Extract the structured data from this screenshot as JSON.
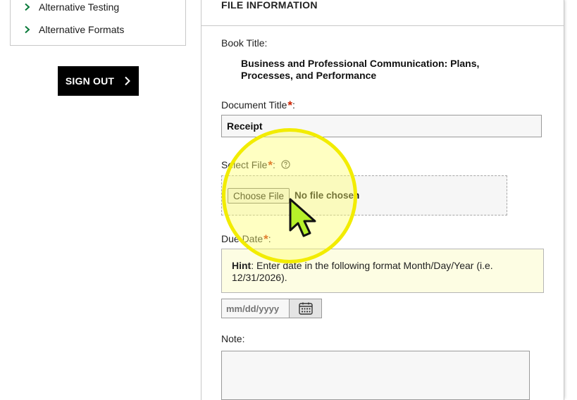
{
  "sidebar": {
    "items": [
      {
        "label": "Alternative Testing",
        "icon": "chevron-right-icon"
      },
      {
        "label": "Alternative Formats",
        "icon": "chevron-right-icon"
      }
    ],
    "sign_out_label": "SIGN OUT",
    "sign_out_icon": "chevron-right-icon"
  },
  "form": {
    "section_title": "FILE INFORMATION",
    "book_title_label": "Book Title:",
    "book_title_value": "Business and Professional Communication: Plans, Processes, and Performance",
    "document_title_label": "Document Title",
    "document_title_value": "Receipt",
    "select_file_label": "Select File",
    "help_icon": "question-circle-icon",
    "choose_file_label": "Choose File",
    "no_file_text": "No file chosen",
    "due_date_label": "Due Date",
    "hint_bold": "Hint",
    "hint_text": ": Enter date in the following format Month/Day/Year (i.e. 12/31/2026).",
    "date_placeholder": "mm/dd/yyyy",
    "calendar_icon": "calendar-icon",
    "note_label": "Note:",
    "required_mark": "*",
    "colon": ":"
  },
  "colors": {
    "accent_green": "#0a7a3a",
    "required_red": "#cc2200",
    "hint_background": "#fdfde3",
    "highlight_yellow": "#f2ec00",
    "cursor_green": "#b6f02a"
  }
}
